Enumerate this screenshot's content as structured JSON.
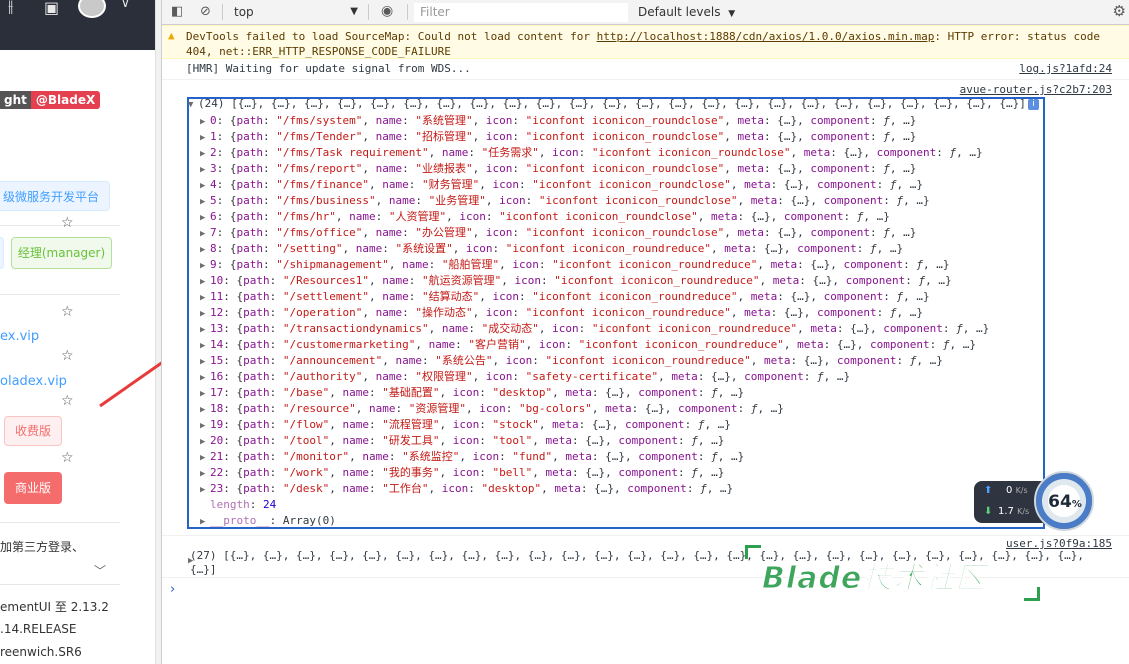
{
  "left_panel": {
    "tag_left": "ght",
    "tag_right": "@BladeX",
    "banner": "级微服务开发平台",
    "role_button": "经理(manager)",
    "link1": "ex.vip",
    "link2": "oladex.vip",
    "pink_button": "收费版",
    "red_button": "商业版",
    "text1": "加第三方登录、",
    "text2": "ementUI 至 2.13.2",
    "text3": ".14.RELEASE",
    "text4": "reenwich.SR6"
  },
  "toolbar": {
    "context": "top",
    "filter_placeholder": "Filter",
    "levels": "Default levels"
  },
  "warning": {
    "prefix": "DevTools failed to load SourceMap: Could not load content for ",
    "url": "http://localhost:1888/cdn/axios/1.0.0/axios.min.map",
    "suffix": ": HTTP error: status code 404, net::ERR_HTTP_RESPONSE_CODE_FAILURE"
  },
  "hmr": {
    "text": "[HMR] Waiting for update signal from WDS...",
    "source": "log.js?1afd:24"
  },
  "router_source": "avue-router.js?c2b7:203",
  "array_header": "(24) [{…}, {…}, {…}, {…}, {…}, {…}, {…}, {…}, {…}, {…}, {…}, {…}, {…}, {…}, {…}, {…}, {…}, {…}, {…}, {…}, {…}, {…}, {…}, {…}]",
  "routes": [
    {
      "i": "0",
      "path": "/fms/system",
      "name": "系统管理",
      "icon": "iconfont iconicon_roundclose"
    },
    {
      "i": "1",
      "path": "/fms/Tender",
      "name": "招标管理",
      "icon": "iconfont iconicon_roundclose"
    },
    {
      "i": "2",
      "path": "/fms/Task requirement",
      "name": "任务需求",
      "icon": "iconfont iconicon_roundclose"
    },
    {
      "i": "3",
      "path": "/fms/report",
      "name": "业绩报表",
      "icon": "iconfont iconicon_roundclose"
    },
    {
      "i": "4",
      "path": "/fms/finance",
      "name": "财务管理",
      "icon": "iconfont iconicon_roundclose"
    },
    {
      "i": "5",
      "path": "/fms/business",
      "name": "业务管理",
      "icon": "iconfont iconicon_roundclose"
    },
    {
      "i": "6",
      "path": "/fms/hr",
      "name": "人资管理",
      "icon": "iconfont iconicon_roundclose"
    },
    {
      "i": "7",
      "path": "/fms/office",
      "name": "办公管理",
      "icon": "iconfont iconicon_roundclose"
    },
    {
      "i": "8",
      "path": "/setting",
      "name": "系统设置",
      "icon": "iconfont iconicon_roundreduce"
    },
    {
      "i": "9",
      "path": "/shipmanagement",
      "name": "船舶管理",
      "icon": "iconfont iconicon_roundreduce"
    },
    {
      "i": "10",
      "path": "/Resources1",
      "name": "航运资源管理",
      "icon": "iconfont iconicon_roundreduce"
    },
    {
      "i": "11",
      "path": "/settlement",
      "name": "结算动态",
      "icon": "iconfont iconicon_roundreduce"
    },
    {
      "i": "12",
      "path": "/operation",
      "name": "操作动态",
      "icon": "iconfont iconicon_roundreduce"
    },
    {
      "i": "13",
      "path": "/transactiondynamics",
      "name": "成交动态",
      "icon": "iconfont iconicon_roundreduce"
    },
    {
      "i": "14",
      "path": "/customermarketing",
      "name": "客户营销",
      "icon": "iconfont iconicon_roundreduce"
    },
    {
      "i": "15",
      "path": "/announcement",
      "name": "系统公告",
      "icon": "iconfont iconicon_roundreduce"
    },
    {
      "i": "16",
      "path": "/authority",
      "name": "权限管理",
      "icon": "safety-certificate"
    },
    {
      "i": "17",
      "path": "/base",
      "name": "基础配置",
      "icon": "desktop"
    },
    {
      "i": "18",
      "path": "/resource",
      "name": "资源管理",
      "icon": "bg-colors"
    },
    {
      "i": "19",
      "path": "/flow",
      "name": "流程管理",
      "icon": "stock"
    },
    {
      "i": "20",
      "path": "/tool",
      "name": "研发工具",
      "icon": "tool"
    },
    {
      "i": "21",
      "path": "/monitor",
      "name": "系统监控",
      "icon": "fund"
    },
    {
      "i": "22",
      "path": "/work",
      "name": "我的事务",
      "icon": "bell"
    },
    {
      "i": "23",
      "path": "/desk",
      "name": "工作台",
      "icon": "desktop"
    }
  ],
  "length_label": "length",
  "length_value": "24",
  "proto_label": "__proto__",
  "proto_value": "Array(0)",
  "user_source": "user.js?0f9a:185",
  "bottom_array": "(27) [{…}, {…}, {…}, {…}, {…}, {…}, {…}, {…}, {…}, {…}, {…}, {…}, {…}, {…}, {…}, {…}, {…}, {…}, {…}, {…}, {…}, {…}, {…}, {…}, {…}, {…},\n{…}]",
  "net": {
    "up": "0",
    "up_unit": "K/s",
    "down": "1.7",
    "down_unit": "K/s",
    "cpu": "64",
    "cpu_unit": "%"
  },
  "watermark": "Blade技术社区"
}
